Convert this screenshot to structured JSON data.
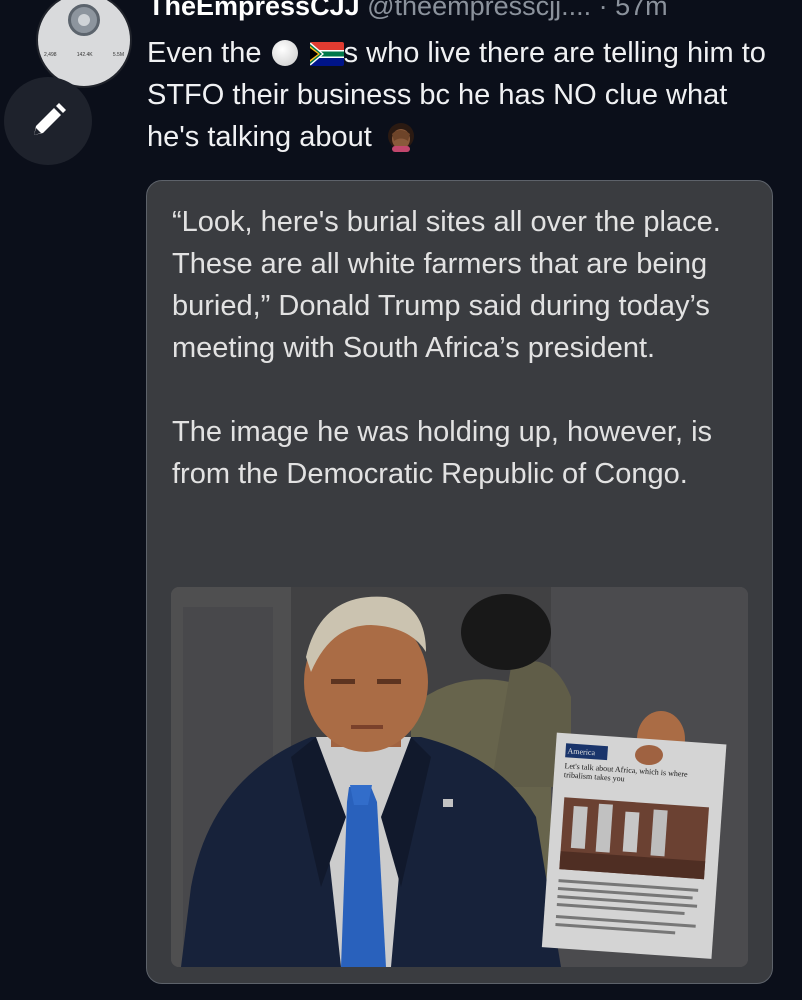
{
  "profile": {
    "stats": [
      "2,498",
      "142.4K",
      "5.5M"
    ]
  },
  "tweet": {
    "display_name": "TheEmpressCJJ",
    "handle": "@theempresscjj....",
    "time": "· 57m",
    "text_part1": "Even the",
    "text_part2": "s who live there are telling him to STFO their business bc he has NO clue what he's talking about"
  },
  "quote_card": {
    "paragraph1": "“Look, here's burial sites all over the place. These are all white farmers that are being buried,” Donald Trump said during today’s meeting with South Africa’s president.",
    "paragraph2": "The image he was holding up, however, is from the Democratic Republic of Congo."
  },
  "photo": {
    "paper_heading": "America",
    "paper_headline": "Let's talk about Africa, which is where tribalism takes you"
  },
  "colors": {
    "background": "#0b0f1a",
    "card_background": "#3a3c40",
    "suit": "#1b2742",
    "tie": "#2f6fd6"
  },
  "icons": [
    "pencil-icon",
    "white-circle-emoji",
    "south-africa-flag-emoji",
    "facepalm-emoji"
  ]
}
